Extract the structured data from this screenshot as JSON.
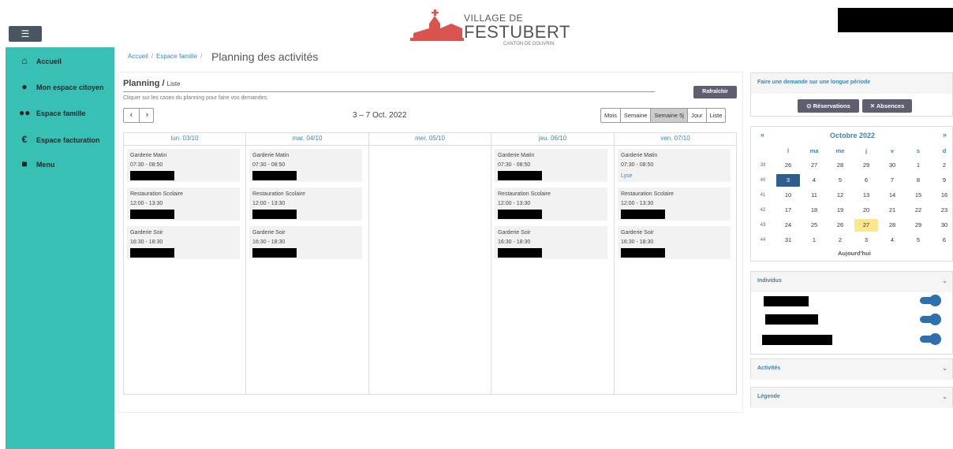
{
  "header": {
    "menu_icon": "hamburger-icon",
    "logo_line1": "VILLAGE DE",
    "logo_line2": "FESTUBERT",
    "logo_line3": "CANTON DE DOUVRIN"
  },
  "sidebar": {
    "items": [
      {
        "icon": "home-icon",
        "label": "Accueil"
      },
      {
        "icon": "user-icon",
        "label": "Mon espace citoyen"
      },
      {
        "icon": "family-icon",
        "label": "Espace famille"
      },
      {
        "icon": "euro-icon",
        "label": "Espace facturation"
      },
      {
        "icon": "square-icon",
        "label": "Menu"
      }
    ]
  },
  "breadcrumb": {
    "home": "Accueil",
    "section": "Espace famille",
    "sep": "/"
  },
  "page_title": "Planning des activités",
  "planning": {
    "title": "Planning /",
    "subtitle": "Liste",
    "hint": "Cliquer sur les cases du planning pour faire vos demandes.",
    "refresh_label": "Rafraîchir",
    "prev": "‹",
    "next": "›",
    "range": "3 – 7 Oct. 2022",
    "views": [
      "Mois",
      "Semaine",
      "Semaine 5j",
      "Jour",
      "Liste"
    ],
    "active_view": "Semaine 5j",
    "days": [
      {
        "label": "lun. 03/10",
        "events": [
          {
            "name": "Garderie Matin",
            "time": "07:30 - 08:50",
            "note": ""
          },
          {
            "name": "Restauration Scolaire",
            "time": "12:00 - 13:30",
            "note": ""
          },
          {
            "name": "Garderie Soir",
            "time": "16:30 - 18:30",
            "note": ""
          }
        ]
      },
      {
        "label": "mar. 04/10",
        "events": [
          {
            "name": "Garderie Matin",
            "time": "07:30 - 08:50",
            "note": ""
          },
          {
            "name": "Restauration Scolaire",
            "time": "12:00 - 13:30",
            "note": ""
          },
          {
            "name": "Garderie Soir",
            "time": "16:30 - 18:30",
            "note": ""
          }
        ]
      },
      {
        "label": "mer. 05/10",
        "events": []
      },
      {
        "label": "jeu. 06/10",
        "events": [
          {
            "name": "Garderie Matin",
            "time": "07:30 - 08:50",
            "note": ""
          },
          {
            "name": "Restauration Scolaire",
            "time": "12:00 - 13:30",
            "note": ""
          },
          {
            "name": "Garderie Soir",
            "time": "16:30 - 18:30",
            "note": ""
          }
        ]
      },
      {
        "label": "ven. 07/10",
        "events": [
          {
            "name": "Garderie Matin",
            "time": "07:30 - 08:50",
            "note": "Lyse"
          },
          {
            "name": "Restauration Scolaire",
            "time": "12:00 - 13:30",
            "note": ""
          },
          {
            "name": "Garderie Soir",
            "time": "16:30 - 18:30",
            "note": ""
          }
        ]
      }
    ]
  },
  "right": {
    "long_request": "Faire une demande sur une longue période",
    "reservations_label": "Réservations",
    "absences_label": "Absences",
    "calendar": {
      "prev": "«",
      "next": "»",
      "month": "Octobre 2022",
      "dow": [
        "l",
        "ma",
        "me",
        "j",
        "v",
        "s",
        "d"
      ],
      "weeks": [
        {
          "num": "39",
          "days": [
            "26",
            "27",
            "28",
            "29",
            "30",
            "1",
            "2"
          ]
        },
        {
          "num": "40",
          "days": [
            "3",
            "4",
            "5",
            "6",
            "7",
            "8",
            "9"
          ]
        },
        {
          "num": "41",
          "days": [
            "10",
            "11",
            "12",
            "13",
            "14",
            "15",
            "16"
          ]
        },
        {
          "num": "42",
          "days": [
            "17",
            "18",
            "19",
            "20",
            "21",
            "22",
            "23"
          ]
        },
        {
          "num": "43",
          "days": [
            "24",
            "25",
            "26",
            "27",
            "28",
            "29",
            "30"
          ]
        },
        {
          "num": "44",
          "days": [
            "31",
            "1",
            "2",
            "3",
            "4",
            "5",
            "6"
          ]
        }
      ],
      "selected": "3",
      "today": "27",
      "today_label": "Aujourd'hui"
    },
    "individus_label": "Individus",
    "individus_count": 3,
    "activites_label": "Activités",
    "legende_label": "Légende"
  },
  "colors": {
    "sidebar": "#37c0b3",
    "accent": "#3a85b5",
    "button": "#5d5e70",
    "toggle": "#2e6fb0",
    "today": "#fde78a",
    "selected": "#2e5e8e"
  }
}
